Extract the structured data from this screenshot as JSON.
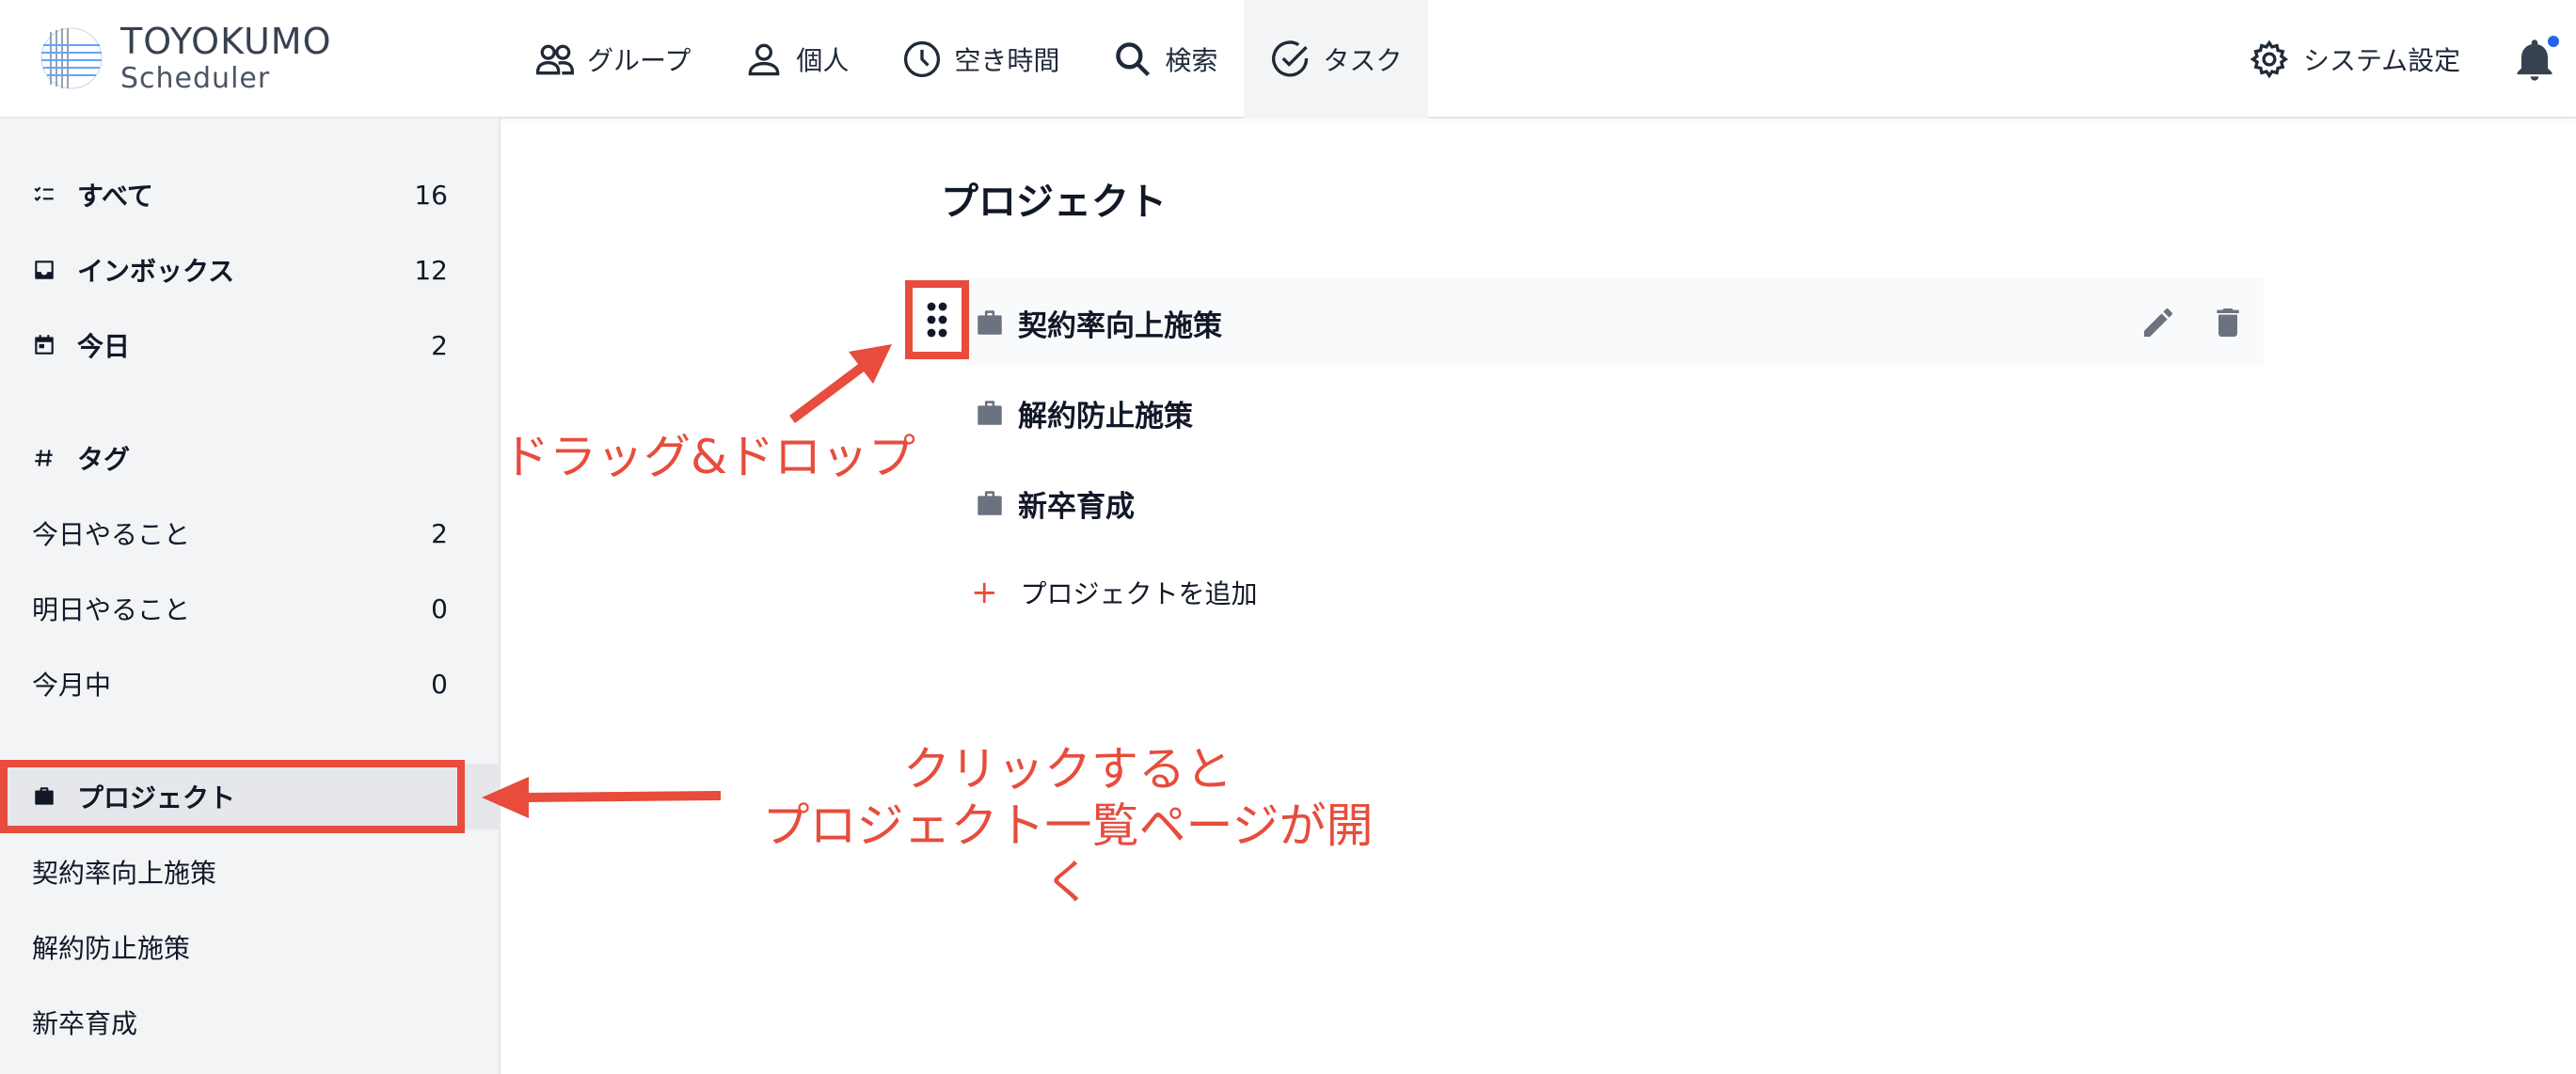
{
  "header": {
    "logo_title": "TOYOKUMO",
    "logo_subtitle": "Scheduler",
    "nav": [
      {
        "label": "グループ",
        "icon": "group-icon"
      },
      {
        "label": "個人",
        "icon": "person-icon"
      },
      {
        "label": "空き時間",
        "icon": "clock-icon"
      },
      {
        "label": "検索",
        "icon": "search-icon"
      },
      {
        "label": "タスク",
        "icon": "check-circle-icon",
        "active": true
      }
    ],
    "settings_label": "システム設定",
    "notification_dot_color": "#2563eb"
  },
  "sidebar": {
    "items": [
      {
        "label": "すべて",
        "count": "16",
        "icon": "checklist-icon"
      },
      {
        "label": "インボックス",
        "count": "12",
        "icon": "inbox-icon"
      },
      {
        "label": "今日",
        "count": "2",
        "icon": "calendar-icon"
      }
    ],
    "tags_header": "タグ",
    "tags": [
      {
        "label": "今日やること",
        "count": "2"
      },
      {
        "label": "明日やること",
        "count": "0"
      },
      {
        "label": "今月中",
        "count": "0"
      }
    ],
    "projects_header": "プロジェクト",
    "projects": [
      {
        "label": "契約率向上施策"
      },
      {
        "label": "解約防止施策"
      },
      {
        "label": "新卒育成"
      }
    ]
  },
  "main": {
    "title": "プロジェクト",
    "projects": [
      {
        "name": "契約率向上施策"
      },
      {
        "name": "解約防止施策"
      },
      {
        "name": "新卒育成"
      }
    ],
    "add_label": "プロジェクトを追加"
  },
  "annotations": {
    "drag_drop": "ドラッグ&ドロップ",
    "click_line1": "クリックすると",
    "click_line2": "プロジェクト一覧ページが開く",
    "color": "#e74c3c"
  }
}
